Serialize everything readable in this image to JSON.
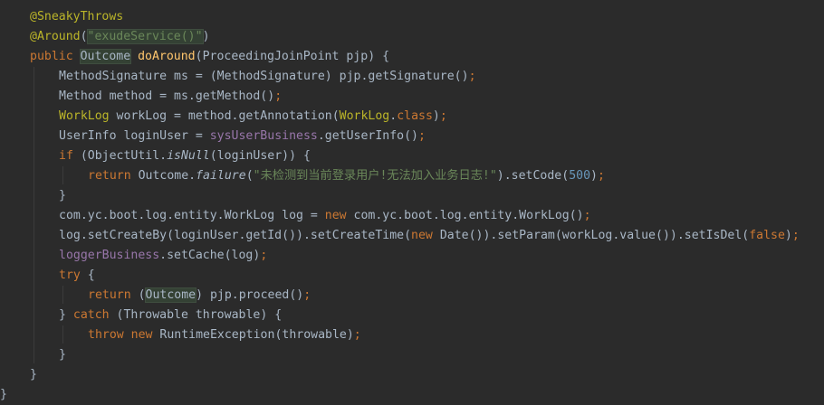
{
  "editor": {
    "lines": [
      {
        "indent": 33,
        "segments": [
          {
            "t": "@SneakyThrows",
            "c": "ann"
          }
        ]
      },
      {
        "indent": 33,
        "segments": [
          {
            "t": "@Around",
            "c": "ann"
          },
          {
            "t": "(",
            "c": ""
          },
          {
            "t": "\"exudeService()\"",
            "c": "str hl"
          },
          {
            "t": ")",
            "c": ""
          }
        ]
      },
      {
        "indent": 33,
        "segments": [
          {
            "t": "public ",
            "c": "kw"
          },
          {
            "t": "Outcome",
            "c": "hl"
          },
          {
            "t": " ",
            "c": ""
          },
          {
            "t": "doAround",
            "c": "fn"
          },
          {
            "t": "(ProceedingJoinPoint pjp) {",
            "c": ""
          }
        ]
      },
      {
        "indent": 65,
        "segments": [
          {
            "t": "MethodSignature ms = (MethodSignature) pjp.getSignature()",
            "c": ""
          },
          {
            "t": ";",
            "c": "kw"
          }
        ]
      },
      {
        "indent": 65,
        "segments": [
          {
            "t": "Method method = ms.getMethod()",
            "c": ""
          },
          {
            "t": ";",
            "c": "kw"
          }
        ]
      },
      {
        "indent": 65,
        "segments": [
          {
            "t": "WorkLog",
            "c": "ann"
          },
          {
            "t": " workLog = method.getAnnotation(",
            "c": ""
          },
          {
            "t": "WorkLog",
            "c": "ann"
          },
          {
            "t": ".",
            "c": ""
          },
          {
            "t": "class",
            "c": "kw"
          },
          {
            "t": ")",
            "c": ""
          },
          {
            "t": ";",
            "c": "kw"
          }
        ]
      },
      {
        "indent": 65,
        "segments": [
          {
            "t": "UserInfo loginUser = ",
            "c": ""
          },
          {
            "t": "sysUserBusiness",
            "c": "field"
          },
          {
            "t": ".getUserInfo()",
            "c": ""
          },
          {
            "t": ";",
            "c": "kw"
          }
        ]
      },
      {
        "indent": 65,
        "segments": [
          {
            "t": "if ",
            "c": "kw"
          },
          {
            "t": "(ObjectUtil.",
            "c": ""
          },
          {
            "t": "isNull",
            "c": "ital"
          },
          {
            "t": "(loginUser)) {",
            "c": ""
          }
        ]
      },
      {
        "indent": 97,
        "segments": [
          {
            "t": "return ",
            "c": "kw"
          },
          {
            "t": "Outcome.",
            "c": ""
          },
          {
            "t": "failure",
            "c": "ital"
          },
          {
            "t": "(",
            "c": ""
          },
          {
            "t": "\"未检测到当前登录用户!无法加入业务日志!\"",
            "c": "str"
          },
          {
            "t": ").setCode(",
            "c": ""
          },
          {
            "t": "500",
            "c": "num"
          },
          {
            "t": ")",
            "c": ""
          },
          {
            "t": ";",
            "c": "kw"
          }
        ]
      },
      {
        "indent": 65,
        "segments": [
          {
            "t": "}",
            "c": ""
          }
        ]
      },
      {
        "indent": 65,
        "segments": [
          {
            "t": "com.yc.boot.log.entity.WorkLog log = ",
            "c": ""
          },
          {
            "t": "new ",
            "c": "kw"
          },
          {
            "t": "com.yc.boot.log.entity.WorkLog()",
            "c": ""
          },
          {
            "t": ";",
            "c": "kw"
          }
        ]
      },
      {
        "indent": 65,
        "segments": [
          {
            "t": "log.setCreateBy(loginUser.getId()).setCreateTime(",
            "c": ""
          },
          {
            "t": "new ",
            "c": "kw"
          },
          {
            "t": "Date()).setParam(workLog.value()).setIsDel(",
            "c": ""
          },
          {
            "t": "false",
            "c": "kw"
          },
          {
            "t": ")",
            "c": ""
          },
          {
            "t": ";",
            "c": "kw"
          }
        ]
      },
      {
        "indent": 65,
        "segments": [
          {
            "t": "loggerBusiness",
            "c": "field"
          },
          {
            "t": ".setCache(log)",
            "c": ""
          },
          {
            "t": ";",
            "c": "kw"
          }
        ]
      },
      {
        "indent": 65,
        "segments": [
          {
            "t": "try ",
            "c": "kw"
          },
          {
            "t": "{",
            "c": ""
          }
        ]
      },
      {
        "indent": 97,
        "segments": [
          {
            "t": "return ",
            "c": "kw"
          },
          {
            "t": "(",
            "c": ""
          },
          {
            "t": "Outcome",
            "c": "hl"
          },
          {
            "t": ") pjp.proceed()",
            "c": ""
          },
          {
            "t": ";",
            "c": "kw"
          }
        ]
      },
      {
        "indent": 65,
        "segments": [
          {
            "t": "} ",
            "c": ""
          },
          {
            "t": "catch ",
            "c": "kw"
          },
          {
            "t": "(Throwable throwable) {",
            "c": ""
          }
        ]
      },
      {
        "indent": 97,
        "segments": [
          {
            "t": "throw new ",
            "c": "kw"
          },
          {
            "t": "RuntimeException(throwable)",
            "c": ""
          },
          {
            "t": ";",
            "c": "kw"
          }
        ]
      },
      {
        "indent": 65,
        "segments": [
          {
            "t": "}",
            "c": ""
          }
        ]
      },
      {
        "indent": 33,
        "segments": [
          {
            "t": "}",
            "c": ""
          }
        ]
      },
      {
        "indent": 0,
        "segments": [
          {
            "t": "}",
            "c": ""
          }
        ]
      }
    ]
  }
}
